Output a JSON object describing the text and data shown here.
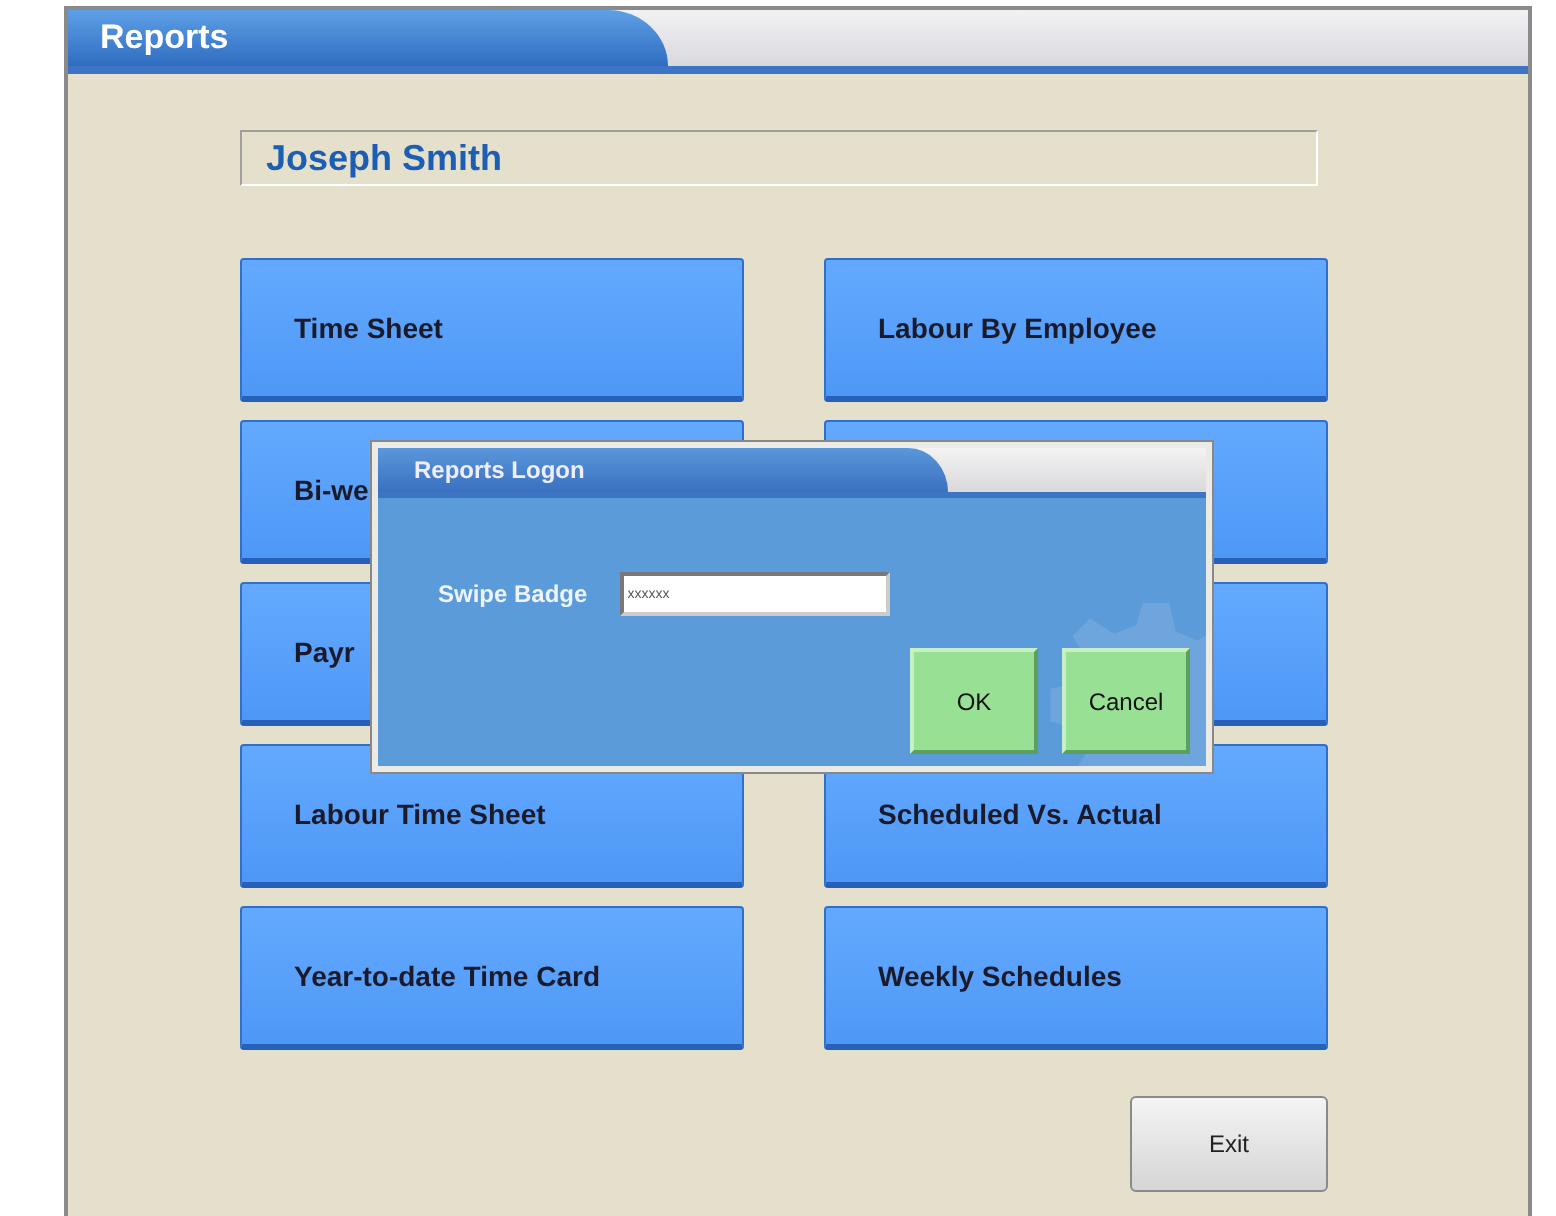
{
  "window": {
    "title": "Reports"
  },
  "employee_name": "Joseph Smith",
  "report_buttons": [
    {
      "kind": "labelled",
      "label": "Time Sheet"
    },
    {
      "kind": "labelled",
      "label": "Labour By Employee"
    },
    {
      "kind": "labelled",
      "label": "Bi-we"
    },
    {
      "kind": "hidden"
    },
    {
      "kind": "labelled",
      "label": "Payr"
    },
    {
      "kind": "hidden"
    },
    {
      "kind": "labelled",
      "label": "Labour Time Sheet"
    },
    {
      "kind": "labelled",
      "label": "Scheduled Vs. Actual"
    },
    {
      "kind": "labelled",
      "label": "Year-to-date Time Card"
    },
    {
      "kind": "labelled",
      "label": "Weekly Schedules"
    }
  ],
  "exit_button": "Exit",
  "dialog": {
    "title": "Reports Logon",
    "field_label": "Swipe Badge",
    "field_value": "xxxxxx",
    "buttons": [
      "OK",
      "Cancel"
    ]
  }
}
